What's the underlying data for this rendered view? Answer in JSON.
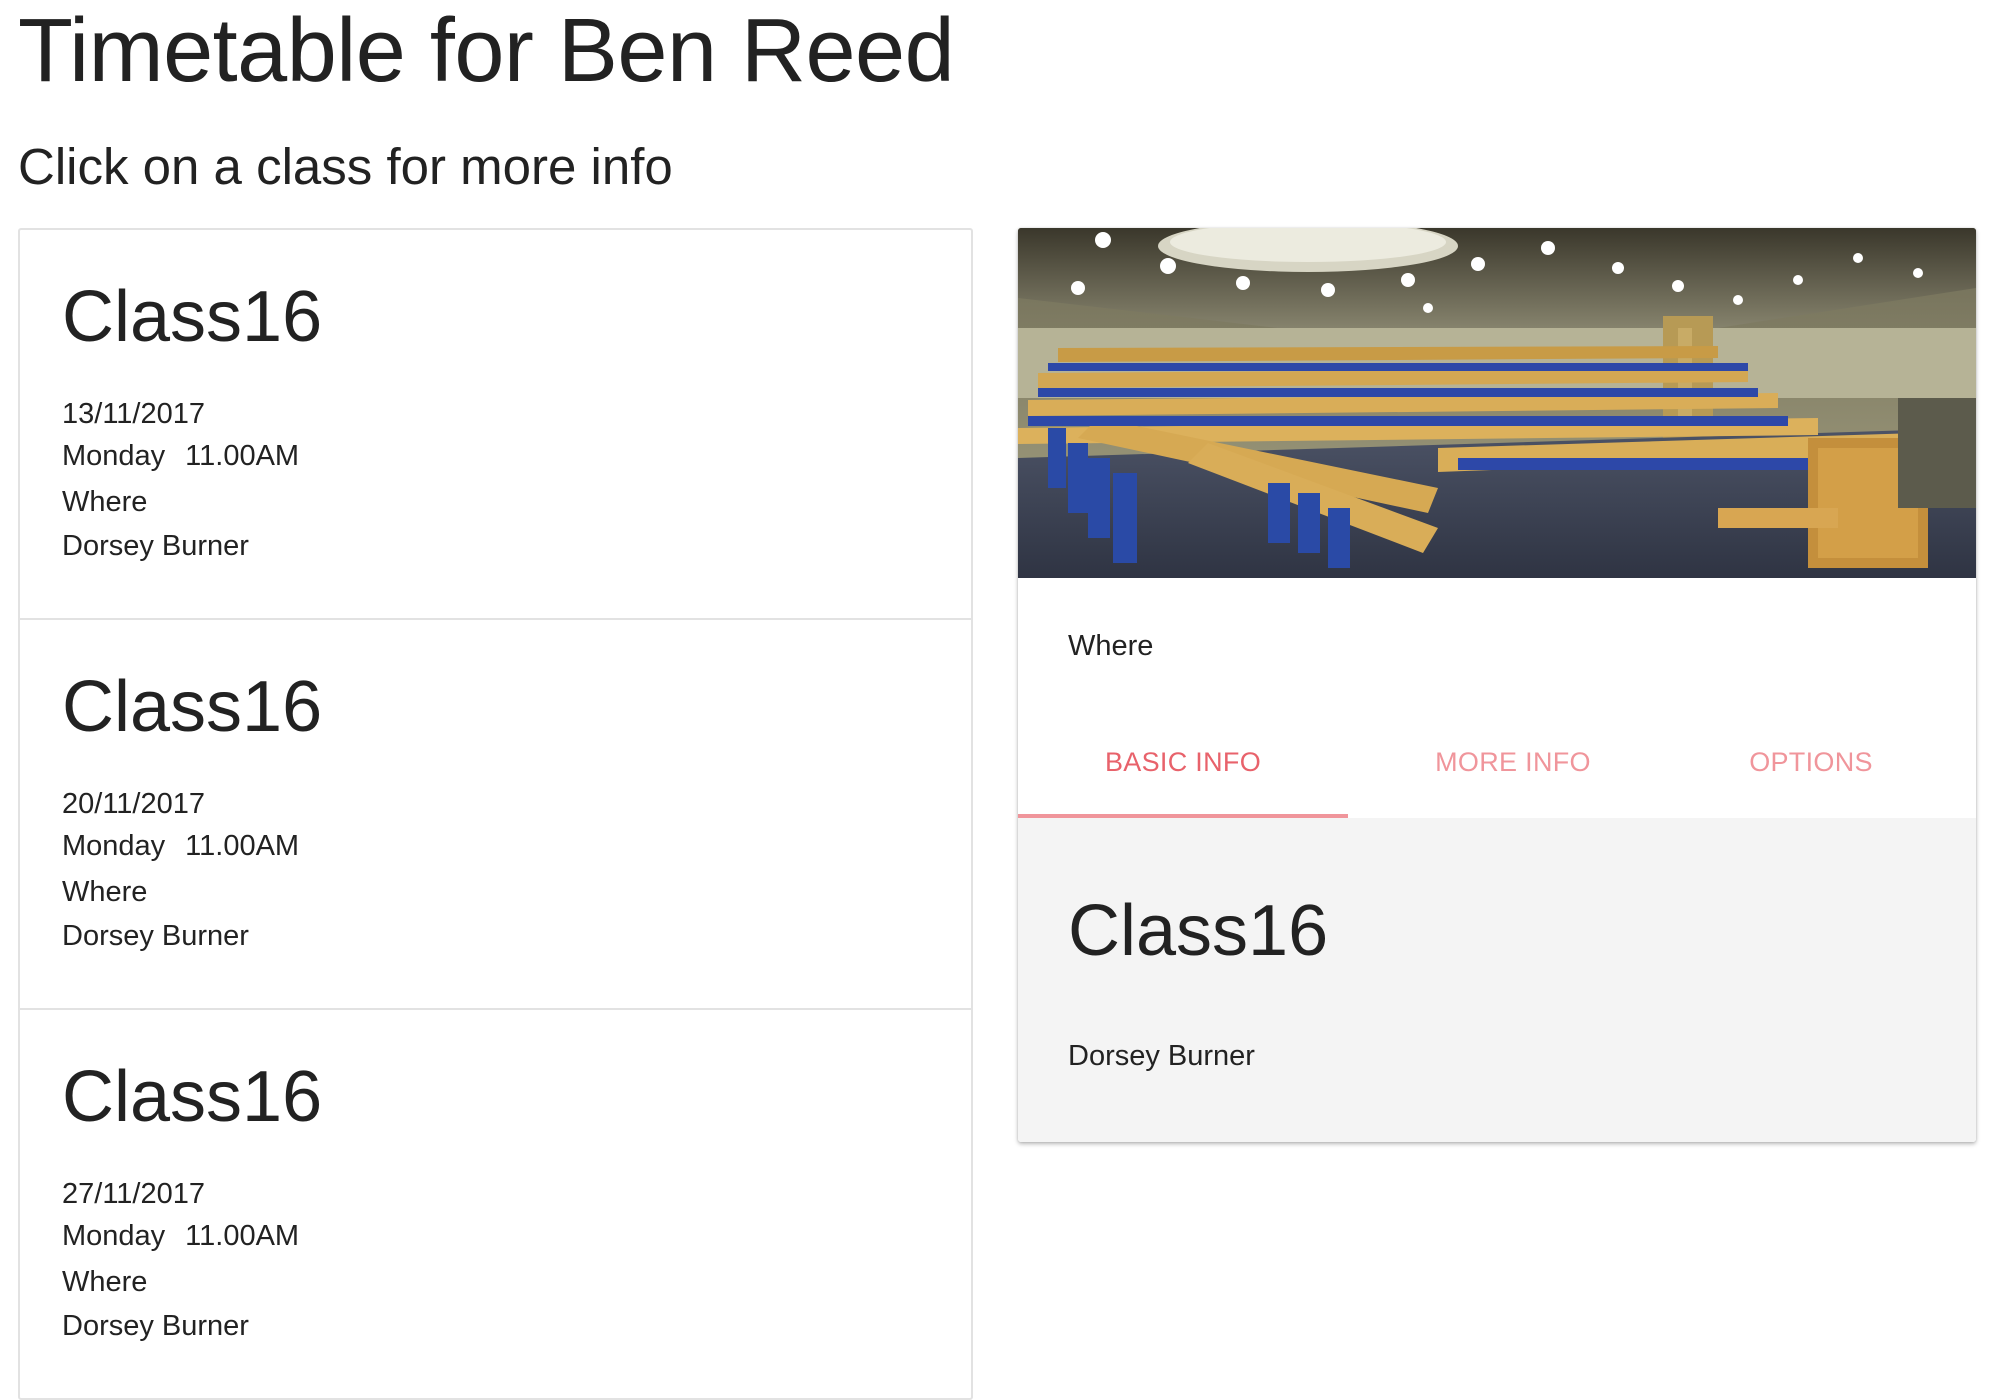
{
  "page": {
    "title": "Timetable for Ben Reed",
    "subtitle": "Click on a class for more info"
  },
  "classes": [
    {
      "title": "Class16",
      "date": "13/11/2017",
      "day": "Monday",
      "time": "11.00AM",
      "where": "Where",
      "teacher": "Dorsey Burner"
    },
    {
      "title": "Class16",
      "date": "20/11/2017",
      "day": "Monday",
      "time": "11.00AM",
      "where": "Where",
      "teacher": "Dorsey Burner"
    },
    {
      "title": "Class16",
      "date": "27/11/2017",
      "day": "Monday",
      "time": "11.00AM",
      "where": "Where",
      "teacher": "Dorsey Burner"
    }
  ],
  "detail": {
    "image_icon": "lecture-hall-photo",
    "where": "Where",
    "tabs": [
      {
        "label": "BASIC INFO",
        "active": true
      },
      {
        "label": "MORE INFO",
        "active": false
      },
      {
        "label": "OPTIONS",
        "active": false
      }
    ],
    "panel": {
      "title": "Class16",
      "teacher": "Dorsey Burner"
    }
  },
  "colors": {
    "tab_active": "#e8626b",
    "tab_inactive": "#f0959b",
    "panel_bg": "#f4f4f4",
    "border": "#e2e2e2"
  }
}
